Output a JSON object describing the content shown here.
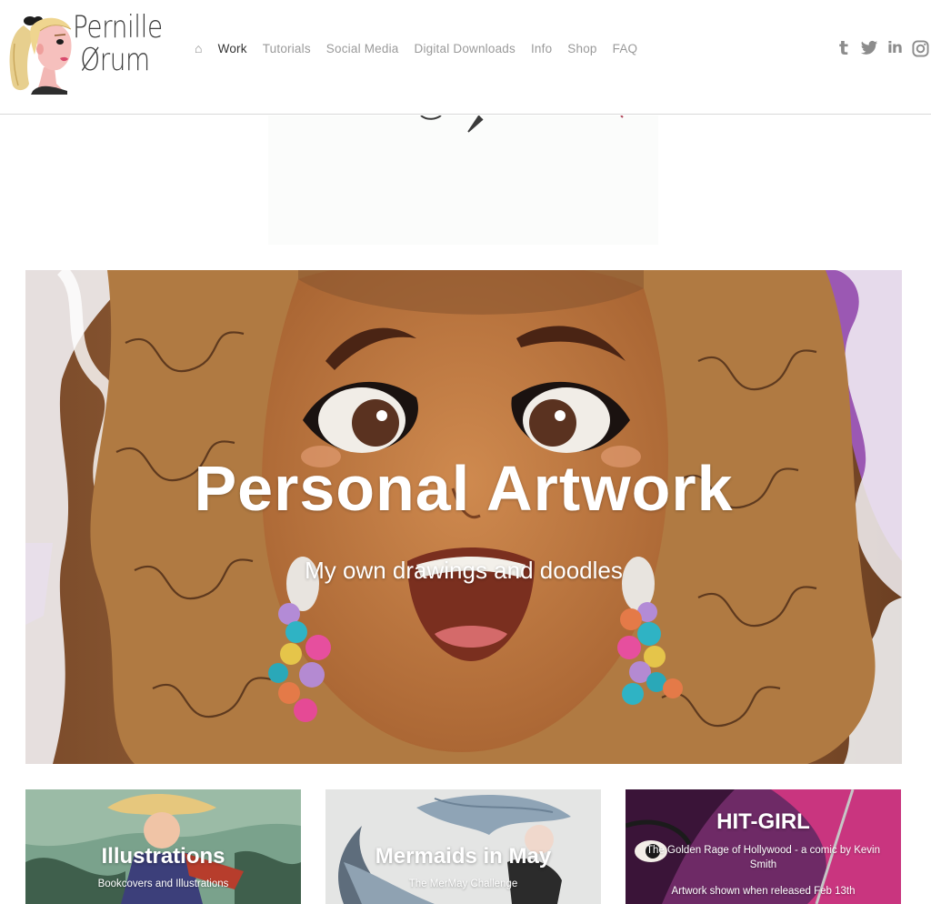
{
  "brand": {
    "line1": "Pernille",
    "line2": "Ørum"
  },
  "nav": {
    "home_label": "⌂",
    "items": [
      "Work",
      "Tutorials",
      "Social Media",
      "Digital Downloads",
      "Info",
      "Shop",
      "FAQ"
    ],
    "active": "Work"
  },
  "social": [
    "tumblr-icon",
    "twitter-icon",
    "linkedin-icon",
    "instagram-icon"
  ],
  "hero": {
    "title": "Personal Artwork",
    "subtitle": "My own drawings and doodles"
  },
  "cards": [
    {
      "title": "Illustrations",
      "subtitle": "Bookcovers and Illustrations"
    },
    {
      "title": "Mermaids in May",
      "subtitle": "The MerMay Challenge"
    },
    {
      "title": "HIT-GIRL",
      "subtitle": "The Golden Rage of Hollywood - a comic by Kevin Smith",
      "subtitle2": "Artwork shown when released Feb 13th"
    }
  ],
  "colors": {
    "nav_active": "#333333",
    "nav_inactive": "#9a9a9a",
    "icon_gray": "#8c8c8c"
  }
}
